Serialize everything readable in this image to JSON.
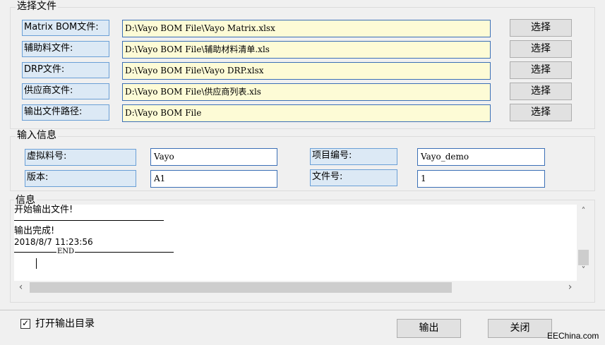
{
  "file_group": {
    "title": "选择文件",
    "rows": [
      {
        "label": "Matrix BOM文件:",
        "path": "D:\\Vayo BOM File\\Vayo Matrix.xlsx",
        "button": "选择"
      },
      {
        "label": "辅助料文件:",
        "path": "D:\\Vayo BOM File\\辅助材料清单.xls",
        "button": "选择"
      },
      {
        "label": "DRP文件:",
        "path": "D:\\Vayo BOM File\\Vayo DRP.xlsx",
        "button": "选择"
      },
      {
        "label": "供应商文件:",
        "path": "D:\\Vayo BOM File\\供应商列表.xls",
        "button": "选择"
      },
      {
        "label": "输出文件路径:",
        "path": "D:\\Vayo BOM File",
        "button": "选择"
      }
    ]
  },
  "input_group": {
    "title": "输入信息",
    "fields": [
      {
        "label": "虚拟料号:",
        "value": "Vayo"
      },
      {
        "label": "项目编号:",
        "value": "Vayo_demo"
      },
      {
        "label": "版本:",
        "value": "A1"
      },
      {
        "label": "文件号:",
        "value": "1"
      }
    ]
  },
  "info_group": {
    "title": "信息",
    "log_lines": [
      "开始输出文件!",
      "输出完成!",
      "2018/8/7 11:23:56",
      "END"
    ]
  },
  "footer": {
    "checkbox_label": "打开输出目录",
    "checkbox_checked": true,
    "output_button": "输出",
    "close_button": "关闭"
  },
  "watermark": "EEChina.com"
}
